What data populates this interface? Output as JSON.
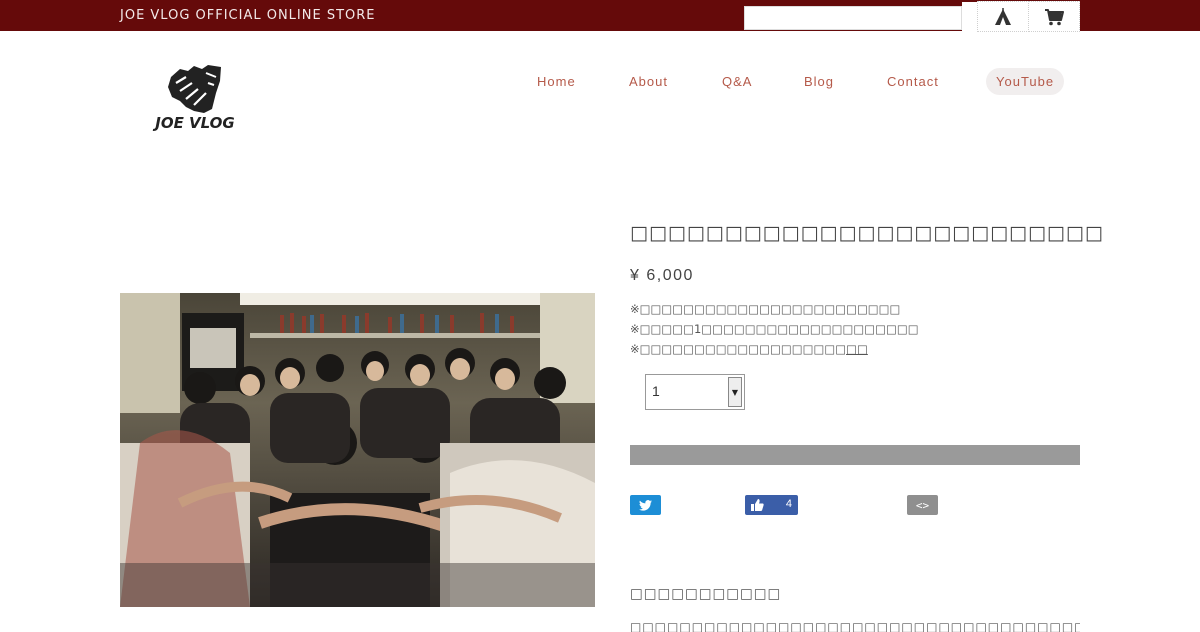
{
  "topbar": {
    "store_name": "JOE VLOG OFFICIAL ONLINE STORE",
    "search": {
      "value": "",
      "placeholder": ""
    },
    "tent_icon": "tent-icon",
    "cart_icon": "cart-icon"
  },
  "header": {
    "logo_text": "JOE VLOG"
  },
  "nav": {
    "items": [
      {
        "label": "Home"
      },
      {
        "label": "About"
      },
      {
        "label": "Q&A"
      },
      {
        "label": "Blog"
      },
      {
        "label": "Contact"
      },
      {
        "label": "YouTube"
      }
    ]
  },
  "product": {
    "title": "□□□□□□□□□□□□□□□□□□□□□□□□□",
    "price": "¥ 6,000",
    "notes": [
      "※□□□□□□□□□□□□□□□□□□□□□□□□",
      "※□□□□□1□□□□□□□□□□□□□□□□□□□□",
      "※□□□□□□□□□□□□□□□□□□□"
    ],
    "notes_link": "□□",
    "quantity": "1",
    "description_heading": "□□□□□□□□□□□",
    "description_body": "□□□□□□□□□□□□□□□□□□□□□□□□□□□□□□□□□□□□□□□□□□□□□□□□□□□□□□□□"
  },
  "share": {
    "facebook_count": "4",
    "embed_label": "<>"
  },
  "colors": {
    "topbar": "#650a0a",
    "nav_text": "#b55a4a",
    "cart_bar": "#9a9a9a",
    "twitter": "#1d8ed6",
    "facebook": "#3b5ea8"
  }
}
